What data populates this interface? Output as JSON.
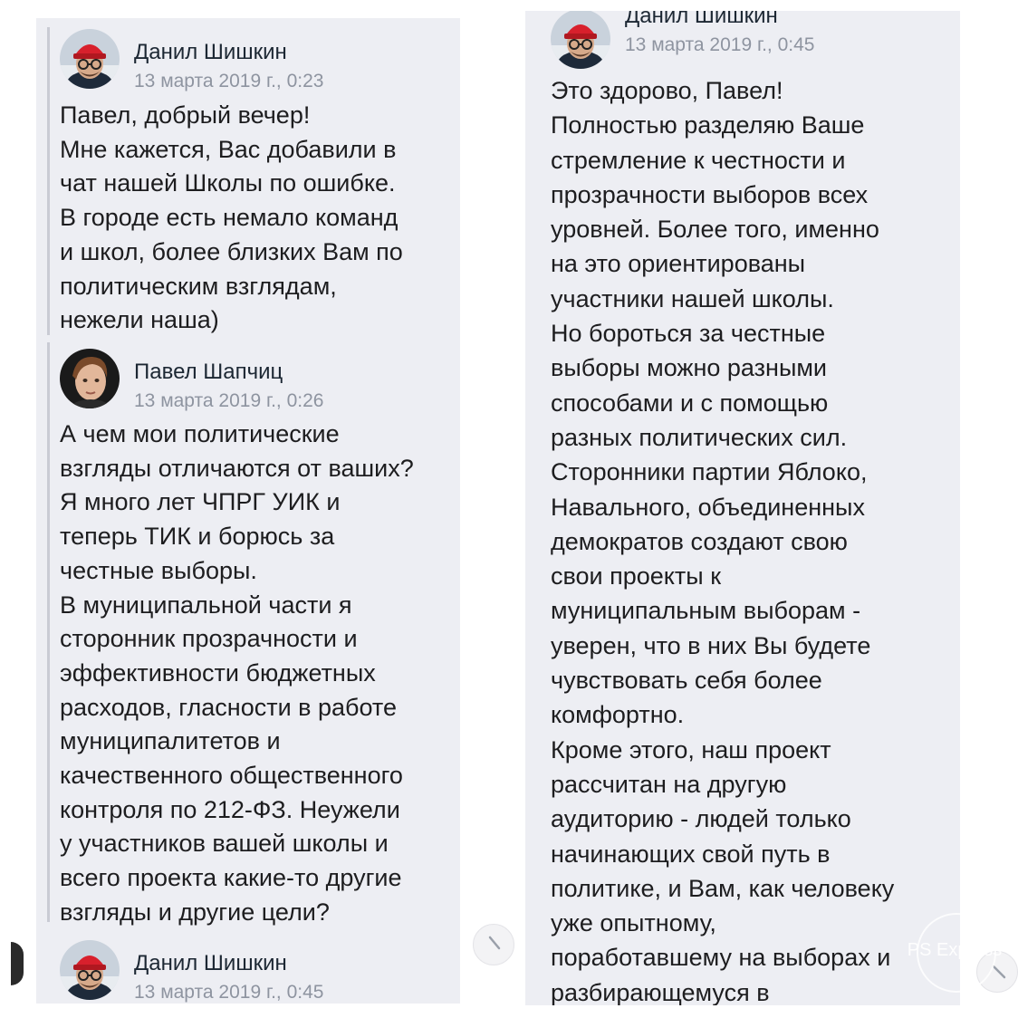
{
  "left_panel": {
    "messages": [
      {
        "author": "Данил Шишкин",
        "date": "13 марта 2019 г., 0:23",
        "lines": [
          "Павел, добрый вечер!",
          "Мне кажется, Вас добавили в",
          "чат нашей Школы по ошибке.",
          "В городе есть немало команд",
          "и школ, более близких Вам по",
          "политическим взглядам,",
          "нежели наша)"
        ]
      },
      {
        "author": "Павел Шапчиц",
        "date": "13 марта 2019 г., 0:26",
        "lines": [
          "А чем мои политические",
          "взгляды отличаются от ваших?",
          "Я много лет ЧПРГ УИК и",
          "теперь ТИК и борюсь за",
          "честные выборы.",
          "В муниципальной части я",
          "сторонник прозрачности и",
          "эффективности бюджетных",
          "расходов, гласности в работе",
          "муниципалитетов и",
          "качественного общественного",
          "контроля по 212-ФЗ. Неужели",
          "у участников вашей школы и",
          "всего проекта какие-то другие",
          "взгляды и другие цели?"
        ]
      },
      {
        "author": "Данил Шишкин",
        "date": "13 марта 2019 г., 0:45",
        "lines": []
      }
    ]
  },
  "right_panel": {
    "messages": [
      {
        "author": "Данил Шишкин",
        "date": "13 марта 2019 г., 0:45",
        "lines": [
          "Это здорово, Павел!",
          "Полностью разделяю Ваше",
          "стремление к честности и",
          "прозрачности выборов всех",
          "уровней. Более того, именно",
          "на это ориентированы",
          "участники нашей школы.",
          "Но бороться за честные",
          "выборы можно разными",
          "способами и с помощью",
          "разных политических сил.",
          "Сторонники партии Яблоко,",
          "Навального, объединенных",
          "демократов создают свою",
          "свои проекты к",
          "муниципальным выборам -",
          "уверен, что в них Вы будете",
          "чувствовать себя более",
          "комфортно.",
          "Кроме этого, наш проект",
          "рассчитан на другую",
          "аудиторию - людей только",
          "начинающих свой путь в",
          "политике, и Вам, как человеку",
          "уже опытному,",
          "поработавшему на выборах и",
          "разбирающемуся в"
        ]
      }
    ]
  },
  "watermark": {
    "text": "PS Express"
  },
  "colors": {
    "panel_bg": "#edeef3",
    "date_text": "#8e94a0",
    "hat_red": "#d8202c"
  },
  "icons": {
    "danil_avatar": "avatar-red-hat-glasses",
    "pavel_avatar": "avatar-portrait",
    "nav_chevron": "chevron-icon"
  }
}
